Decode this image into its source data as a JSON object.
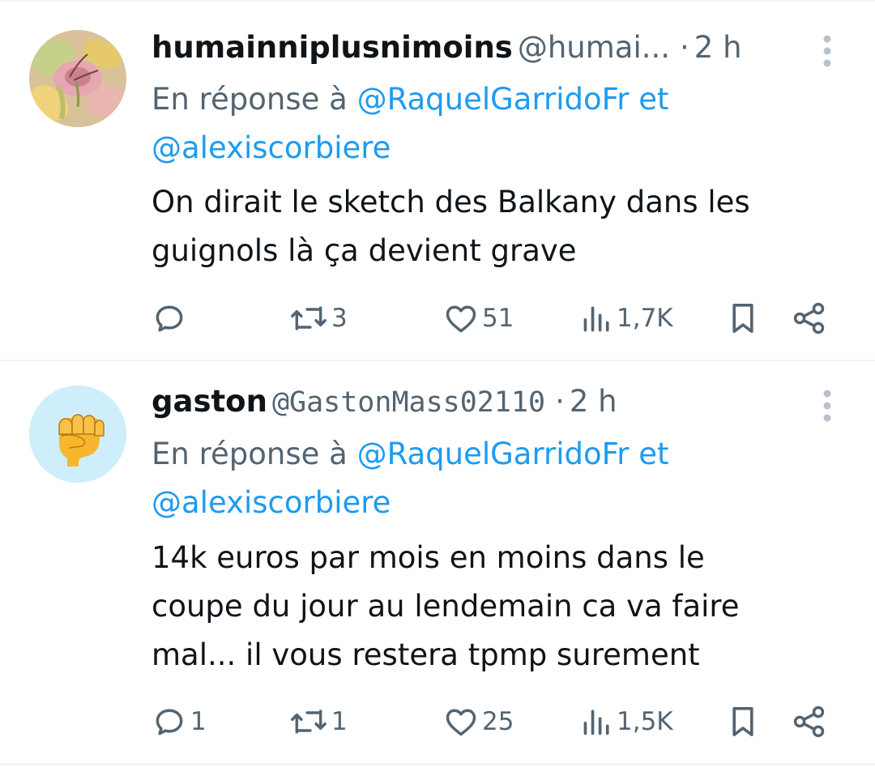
{
  "tweets": [
    {
      "name": "humainniplusnimoins",
      "handle": "@humai...",
      "dot": "·",
      "time": "2 h",
      "reply_prefix": "En réponse à",
      "reply_mention_1": "@RaquelGarridoFr",
      "reply_and": "et",
      "reply_mention_2": "@alexiscorbiere",
      "text_line_1": "On dirait le sketch des Balkany dans les",
      "text_line_2": "guignols là ça devient grave",
      "text_line_3": "",
      "replies": "",
      "retweets": "3",
      "likes": "51",
      "views": "1,7K",
      "avatar_icon": "flower-photo"
    },
    {
      "name": "gaston",
      "handle": "@GastonMass02110",
      "dot": "·",
      "time": "2 h",
      "reply_prefix": "En réponse à",
      "reply_mention_1": "@RaquelGarridoFr",
      "reply_and": "et",
      "reply_mention_2": "@alexiscorbiere",
      "text_line_1": "14k euros par mois en moins dans le",
      "text_line_2": "coupe du jour au lendemain ca va faire",
      "text_line_3": "mal... il vous restera tpmp surement",
      "replies": "1",
      "retweets": "1",
      "likes": "25",
      "views": "1,5K",
      "avatar_icon": "raised-fist-emoji"
    }
  ],
  "colors": {
    "text": "#0f1419",
    "secondary": "#536471",
    "link": "#1d9bf0",
    "divider": "#eff3f4",
    "avatar2_bg": "#cfeefb",
    "fist": "#f6b72e"
  }
}
